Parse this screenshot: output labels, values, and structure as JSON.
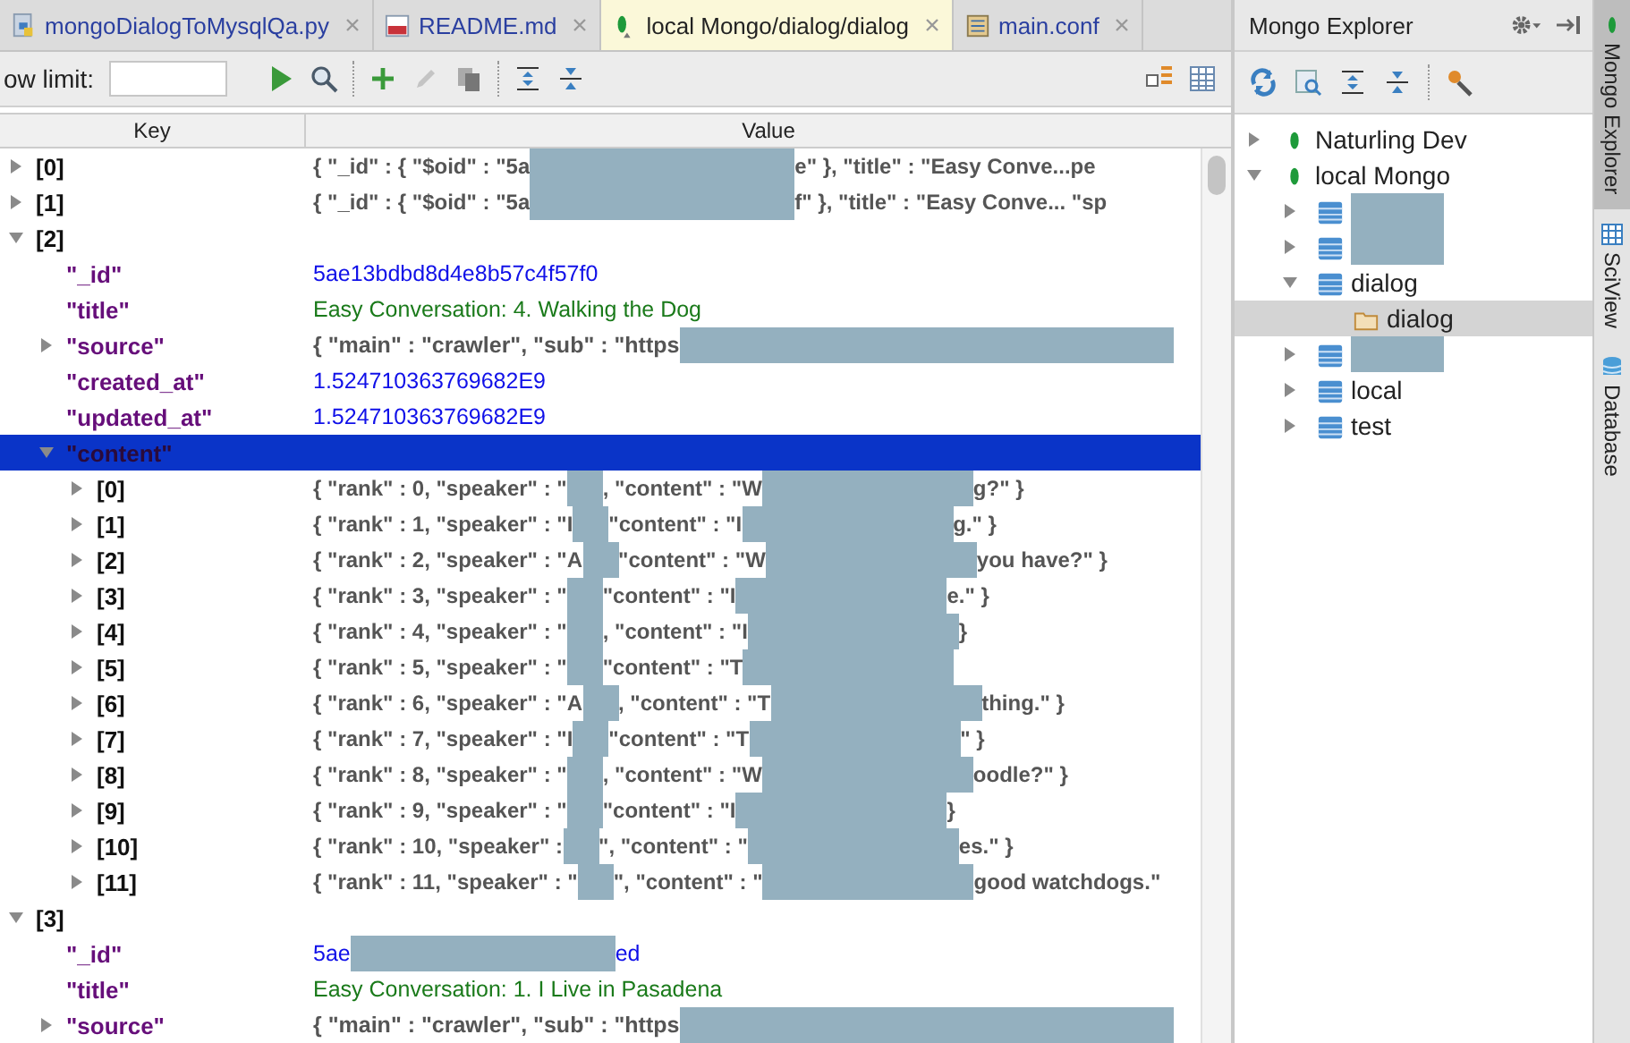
{
  "tabs": [
    {
      "label": "mongoDialogToMysqlQa.py",
      "selected": false
    },
    {
      "label": "README.md",
      "selected": false
    },
    {
      "label": "local Mongo/dialog/dialog",
      "selected": true
    },
    {
      "label": "main.conf",
      "selected": false
    }
  ],
  "toolbar": {
    "row_limit_label": "ow limit:"
  },
  "table": {
    "columns": [
      "Key",
      "Value"
    ],
    "rows": [
      {
        "key": "[0]",
        "kind": "element",
        "value": [
          "{ \"_id\" : { \"$oid\" : \"5a",
          "e\" }, \"title\" : \"Easy Conve...pe"
        ],
        "expanded": false,
        "selected": false
      },
      {
        "key": "[1]",
        "kind": "element",
        "value": [
          "{ \"_id\" : { \"$oid\" : \"5a",
          "f\" }, \"title\" : \"Easy Conve... \"sp"
        ],
        "expanded": false,
        "selected": false
      },
      {
        "key": "[2]",
        "kind": "element",
        "expanded": true,
        "selected": false,
        "children": [
          {
            "key": "\"_id\"",
            "kind": "id",
            "value": [
              "5ae13bdbd8d4e8b57c4f57f0"
            ],
            "selected": false
          },
          {
            "key": "\"title\"",
            "kind": "string",
            "value": [
              "Easy Conversation: 4. Walking the Dog"
            ],
            "selected": false
          },
          {
            "key": "\"source\"",
            "kind": "object",
            "value": [
              "{ \"main\" : \"crawler\", \"sub\" : \"https"
            ],
            "tail_redacted": true,
            "expanded": false,
            "selected": false
          },
          {
            "key": "\"created_at\"",
            "kind": "number",
            "value": [
              "1.524710363769682E9"
            ],
            "selected": false
          },
          {
            "key": "\"updated_at\"",
            "kind": "number",
            "value": [
              "1.524710363769682E9"
            ],
            "selected": false
          },
          {
            "key": "\"content\"",
            "kind": "object",
            "expanded": true,
            "selected": true,
            "children": [
              {
                "key": "[0]",
                "kind": "element",
                "value": [
                  "{ \"rank\" : 0, \"speaker\" : \"",
                  ", \"content\" : \"W",
                  "g?\" }"
                ],
                "expanded": false,
                "selected": false
              },
              {
                "key": "[1]",
                "kind": "element",
                "value": [
                  "{ \"rank\" : 1, \"speaker\" : \"I",
                  "\"content\" : \"I",
                  "g.\" }"
                ],
                "expanded": false,
                "selected": false
              },
              {
                "key": "[2]",
                "kind": "element",
                "value": [
                  "{ \"rank\" : 2, \"speaker\" : \"A",
                  "\"content\" : \"W",
                  " you have?\" }"
                ],
                "expanded": false,
                "selected": false
              },
              {
                "key": "[3]",
                "kind": "element",
                "value": [
                  "{ \"rank\" : 3, \"speaker\" : \"",
                  "\"content\" : \"I",
                  "e.\" }"
                ],
                "expanded": false,
                "selected": false
              },
              {
                "key": "[4]",
                "kind": "element",
                "value": [
                  "{ \"rank\" : 4, \"speaker\" : \"",
                  ", \"content\" : \"I",
                  " }"
                ],
                "expanded": false,
                "selected": false
              },
              {
                "key": "[5]",
                "kind": "element",
                "value": [
                  "{ \"rank\" : 5, \"speaker\" : \"",
                  "\"content\" : \"T"
                ],
                "tail_redacted": true,
                "expanded": false,
                "selected": false
              },
              {
                "key": "[6]",
                "kind": "element",
                "value": [
                  "{ \"rank\" : 6, \"speaker\" : \"A",
                  ", \"content\" : \"T",
                  "thing.\" }"
                ],
                "expanded": false,
                "selected": false
              },
              {
                "key": "[7]",
                "kind": "element",
                "value": [
                  "{ \"rank\" : 7, \"speaker\" : \"I",
                  "\"content\" : \"T",
                  "\" }"
                ],
                "expanded": false,
                "selected": false
              },
              {
                "key": "[8]",
                "kind": "element",
                "value": [
                  "{ \"rank\" : 8, \"speaker\" : \"",
                  ", \"content\" : \"W",
                  "oodle?\" }"
                ],
                "expanded": false,
                "selected": false
              },
              {
                "key": "[9]",
                "kind": "element",
                "value": [
                  "{ \"rank\" : 9, \"speaker\" : \"",
                  "\"content\" : \"I",
                  " }"
                ],
                "expanded": false,
                "selected": false
              },
              {
                "key": "[10]",
                "kind": "element",
                "value": [
                  "{ \"rank\" : 10, \"speaker\" : ",
                  "\", \"content\" : \"",
                  "es.\" }"
                ],
                "expanded": false,
                "selected": false
              },
              {
                "key": "[11]",
                "kind": "element",
                "value": [
                  "{ \"rank\" : 11, \"speaker\" : \"",
                  "\", \"content\" : \"",
                  "good watchdogs.\""
                ],
                "expanded": false,
                "selected": false
              }
            ]
          }
        ]
      },
      {
        "key": "[3]",
        "kind": "element",
        "expanded": true,
        "selected": false,
        "children": [
          {
            "key": "\"_id\"",
            "kind": "id",
            "value": [
              "5ae",
              "ed"
            ],
            "selected": false
          },
          {
            "key": "\"title\"",
            "kind": "string",
            "value": [
              "Easy Conversation: 1. I Live in Pasadena"
            ],
            "selected": false
          },
          {
            "key": "\"source\"",
            "kind": "object",
            "value": [
              "{ \"main\" : \"crawler\", \"sub\" : \"https"
            ],
            "tail_redacted": true,
            "expanded": false,
            "selected": false
          }
        ]
      }
    ]
  },
  "explorer": {
    "title": "Mongo Explorer",
    "tree": [
      {
        "label": "Naturling Dev",
        "kind": "server",
        "expanded": false,
        "selected": false
      },
      {
        "label": "local Mongo",
        "kind": "server",
        "expanded": true,
        "selected": false,
        "children": [
          {
            "kind": "database",
            "expanded": false,
            "selected": false
          },
          {
            "kind": "database",
            "expanded": false,
            "selected": false
          },
          {
            "label": "dialog",
            "kind": "database",
            "expanded": true,
            "selected": false,
            "children": [
              {
                "label": "dialog",
                "kind": "collection",
                "selected": true
              }
            ]
          },
          {
            "kind": "database",
            "expanded": false,
            "selected": false
          },
          {
            "label": "local",
            "kind": "database",
            "expanded": false,
            "selected": false
          },
          {
            "label": "test",
            "kind": "database",
            "expanded": false,
            "selected": false
          }
        ]
      }
    ]
  },
  "side_tabs": [
    {
      "label": "Mongo Explorer",
      "selected": true
    },
    {
      "label": "SciView",
      "selected": false
    },
    {
      "label": "Database",
      "selected": false
    }
  ]
}
